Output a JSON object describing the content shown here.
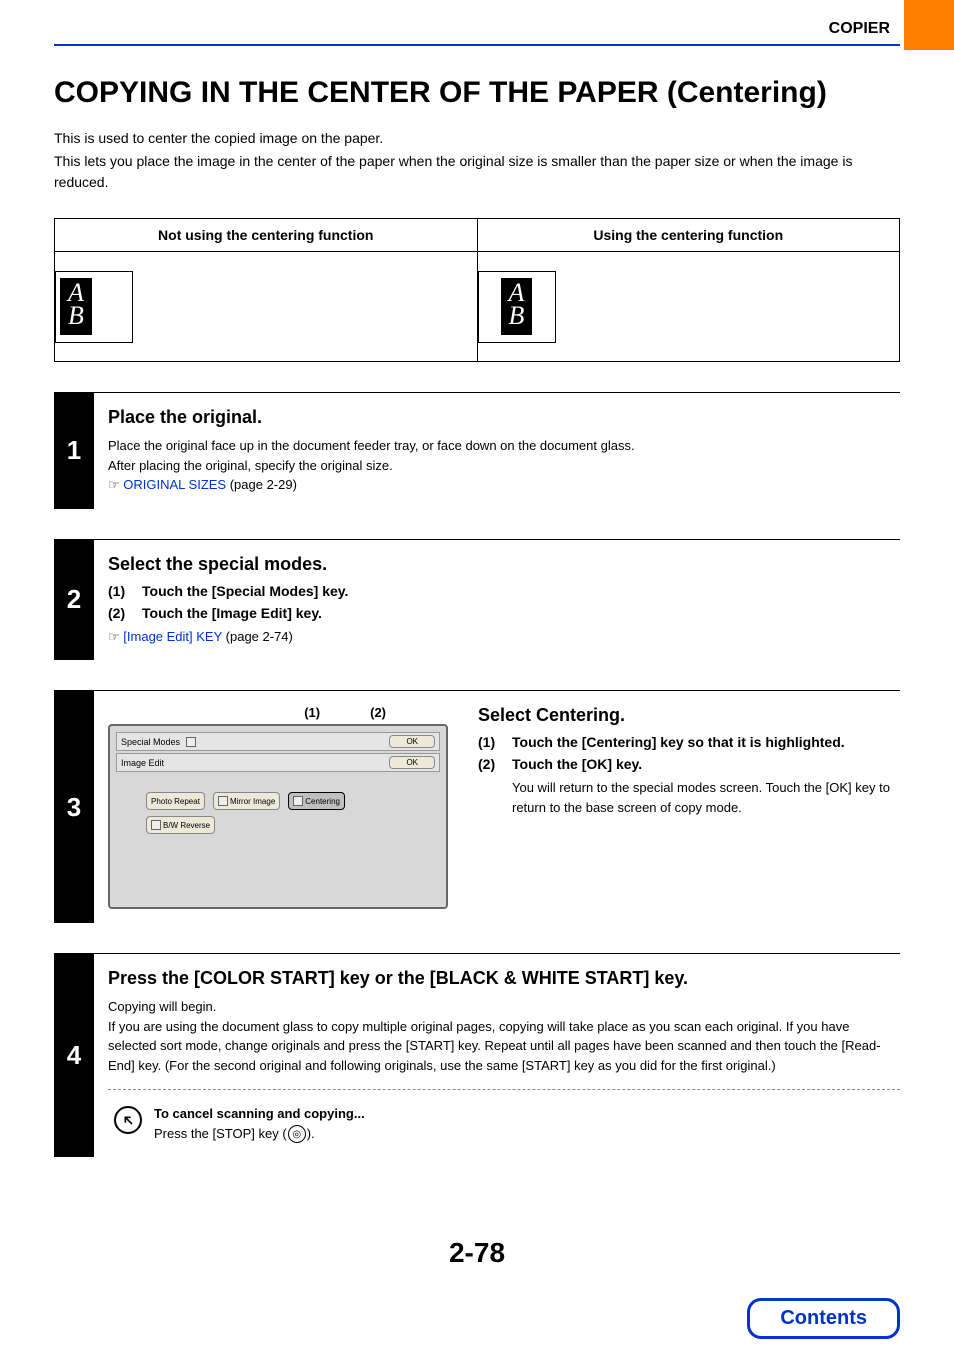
{
  "header": {
    "label": "COPIER"
  },
  "title": "COPYING IN THE CENTER OF THE PAPER (Centering)",
  "intro": {
    "p1": "This is used to center the copied image on the paper.",
    "p2": "This lets you place the image in the center of the paper when the original size is smaller than the paper size or when the image is reduced."
  },
  "compare": {
    "col1": "Not using the centering function",
    "col2": "Using the centering function",
    "block_a": "A",
    "block_b": "B"
  },
  "steps": {
    "s1": {
      "num": "1",
      "title": "Place the original.",
      "p1": "Place the original face up in the document feeder tray, or face down on the document glass.",
      "p2": "After placing the original, specify the original size.",
      "link": "ORIGINAL SIZES",
      "page": " (page 2-29)",
      "pointer": "☞ "
    },
    "s2": {
      "num": "2",
      "title": "Select the special modes.",
      "sub1": {
        "num": "(1)",
        "text": "Touch the [Special Modes] key."
      },
      "sub2": {
        "num": "(2)",
        "text": "Touch the [Image Edit] key."
      },
      "link": "[Image Edit] KEY",
      "page": " (page 2-74)",
      "pointer": "☞ "
    },
    "s3": {
      "num": "3",
      "title": "Select Centering.",
      "callout1": "(1)",
      "callout2": "(2)",
      "screenshot": {
        "special_modes": "Special Modes",
        "image_edit": "Image Edit",
        "ok1": "OK",
        "ok2": "OK",
        "photo_repeat": "Photo Repeat",
        "mirror_image": "Mirror Image",
        "centering": "Centering",
        "bw_reverse": "B/W Reverse"
      },
      "sub1": {
        "num": "(1)",
        "text": "Touch the [Centering] key so that it is highlighted."
      },
      "sub2": {
        "num": "(2)",
        "text": "Touch the [OK] key.",
        "desc": "You will return to the special modes screen. Touch the [OK] key to return to the base screen of copy mode."
      }
    },
    "s4": {
      "num": "4",
      "title": "Press the [COLOR START] key or the [BLACK & WHITE START] key.",
      "p1": "Copying will begin.",
      "p2": "If you are using the document glass to copy multiple original pages, copying will take place as you scan each original. If you have selected sort mode, change originals and press the [START] key. Repeat until all pages have been scanned and then touch the [Read-End] key. (For the second original and following originals, use the same [START] key as you did for the first original.)",
      "cancel_title": "To cancel scanning and copying...",
      "cancel_text_prefix": "Press the [STOP] key (",
      "cancel_text_suffix": ")."
    }
  },
  "page_number": "2-78",
  "contents_btn": "Contents"
}
